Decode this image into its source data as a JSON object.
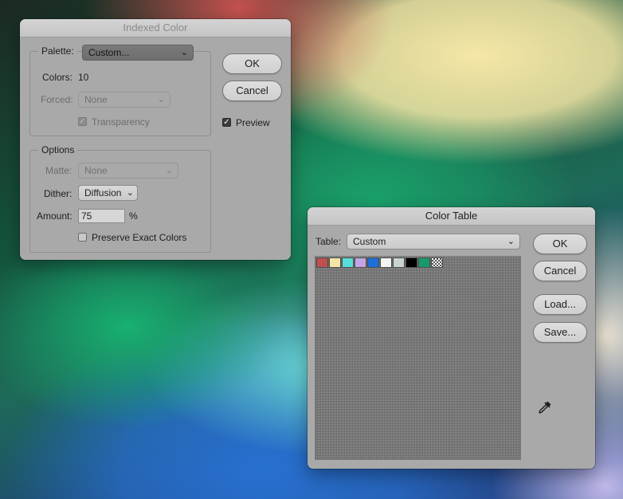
{
  "indexed_color": {
    "title": "Indexed Color",
    "palette": {
      "legend": "Palette:",
      "value": "Custom..."
    },
    "colors": {
      "label": "Colors:",
      "value": "10"
    },
    "forced": {
      "label": "Forced:",
      "value": "None"
    },
    "transparency": {
      "label": "Transparency",
      "checked": true,
      "enabled": false
    },
    "options": {
      "legend": "Options",
      "matte": {
        "label": "Matte:",
        "value": "None"
      },
      "dither": {
        "label": "Dither:",
        "value": "Diffusion"
      },
      "amount": {
        "label": "Amount:",
        "value": "75",
        "unit": "%"
      },
      "preserve_exact": {
        "label": "Preserve Exact Colors",
        "checked": false
      }
    },
    "buttons": {
      "ok": "OK",
      "cancel": "Cancel"
    },
    "preview": {
      "label": "Preview",
      "checked": true
    }
  },
  "color_table": {
    "title": "Color Table",
    "table": {
      "label": "Table:",
      "value": "Custom"
    },
    "swatches": [
      "#c0504d",
      "#f5e6a5",
      "#55dfd8",
      "#c3a5e6",
      "#1e6fd8",
      "#f3f5f2",
      "#c8d4d0",
      "#000000",
      "#159b6b",
      "transparent"
    ],
    "buttons": {
      "ok": "OK",
      "cancel": "Cancel",
      "load": "Load...",
      "save": "Save..."
    },
    "eyedropper_icon": "eyedropper-icon"
  },
  "icons": {
    "chevron": "⌄",
    "checkmark": "✓"
  }
}
